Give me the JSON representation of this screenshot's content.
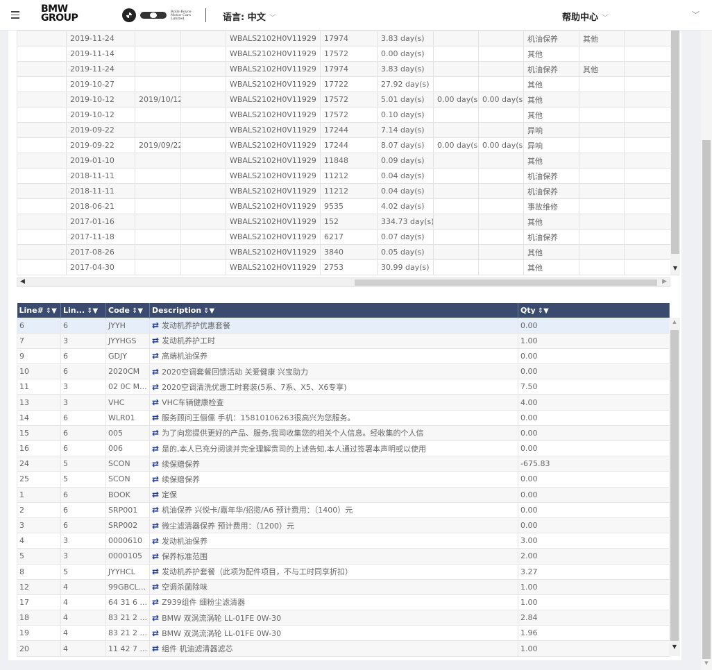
{
  "header": {
    "brand_line1": "BMW",
    "brand_line2": "GROUP",
    "rr_logo_text": "Rolls-Royce Motor Cars Limited",
    "language_label": "语言: 中文",
    "help_label": "帮助中心"
  },
  "repair_orders": {
    "rows": [
      [
        "",
        "2019-11-24",
        "",
        "",
        "WBALS2102H0V11929",
        "17974",
        "3.83 day(s)",
        "",
        "",
        "机油保养",
        "其他",
        ""
      ],
      [
        "",
        "2019-11-14",
        "",
        "",
        "WBALS2102H0V11929",
        "17572",
        "0.00 day(s)",
        "",
        "",
        "其他",
        "",
        ""
      ],
      [
        "",
        "2019-11-24",
        "",
        "",
        "WBALS2102H0V11929",
        "17974",
        "3.83 day(s)",
        "",
        "",
        "机油保养",
        "其他",
        ""
      ],
      [
        "",
        "2019-10-27",
        "",
        "",
        "WBALS2102H0V11929",
        "17722",
        "27.92 day(s)",
        "",
        "",
        "其他",
        "",
        ""
      ],
      [
        "",
        "2019-10-12",
        "2019/10/12",
        "",
        "WBALS2102H0V11929",
        "17572",
        "5.01 day(s)",
        "0.00 day(s)",
        "0.00 day(s)",
        "其他",
        "",
        ""
      ],
      [
        "",
        "2019-10-12",
        "",
        "",
        "WBALS2102H0V11929",
        "17572",
        "0.10 day(s)",
        "",
        "",
        "其他",
        "",
        ""
      ],
      [
        "",
        "2019-09-22",
        "",
        "",
        "WBALS2102H0V11929",
        "17244",
        "7.14 day(s)",
        "",
        "",
        "异响",
        "",
        ""
      ],
      [
        "",
        "2019-09-22",
        "2019/09/22",
        "",
        "WBALS2102H0V11929",
        "17244",
        "8.07 day(s)",
        "0.00 day(s)",
        "0.00 day(s)",
        "异响",
        "",
        ""
      ],
      [
        "",
        "2019-01-10",
        "",
        "",
        "WBALS2102H0V11929",
        "11848",
        "0.09 day(s)",
        "",
        "",
        "其他",
        "",
        ""
      ],
      [
        "",
        "2018-11-11",
        "",
        "",
        "WBALS2102H0V11929",
        "11212",
        "0.04 day(s)",
        "",
        "",
        "机油保养",
        "",
        ""
      ],
      [
        "",
        "2018-11-11",
        "",
        "",
        "WBALS2102H0V11929",
        "11212",
        "0.04 day(s)",
        "",
        "",
        "机油保养",
        "",
        ""
      ],
      [
        "",
        "2018-06-21",
        "",
        "",
        "WBALS2102H0V11929",
        "9535",
        "4.02 day(s)",
        "",
        "",
        "事故维修",
        "",
        ""
      ],
      [
        "",
        "2017-01-16",
        "",
        "",
        "WBALS2102H0V11929",
        "152",
        "334.73 day(s)",
        "",
        "",
        "其他",
        "",
        ""
      ],
      [
        "",
        "2017-11-18",
        "",
        "",
        "WBALS2102H0V11929",
        "6217",
        "0.07 day(s)",
        "",
        "",
        "机油保养",
        "",
        ""
      ],
      [
        "",
        "2017-08-26",
        "",
        "",
        "WBALS2102H0V11929",
        "3840",
        "0.05 day(s)",
        "",
        "",
        "其他",
        "",
        ""
      ],
      [
        "",
        "2017-04-30",
        "",
        "",
        "WBALS2102H0V11929",
        "2753",
        "30.99 day(s)",
        "",
        "",
        "其他",
        "",
        ""
      ]
    ]
  },
  "lines": {
    "headers": [
      "Line#",
      "Lin...",
      "Code",
      "Description",
      "Qty"
    ],
    "rows": [
      [
        "6",
        "6",
        "JYYH",
        "发动机养护优惠套餐",
        "0.00"
      ],
      [
        "7",
        "3",
        "JYYHGS",
        "发动机养护工时",
        "1.00"
      ],
      [
        "9",
        "6",
        "GDJY",
        "高端机油保养",
        "0.00"
      ],
      [
        "10",
        "6",
        "2020CM",
        "2020空调套餐回馈活动 关爱健康 兴宝助力",
        "0.00"
      ],
      [
        "11",
        "3",
        "02 0C M...",
        "2020空调清洗优惠工时套装(5系、7系、X5、X6专享)",
        "7.50"
      ],
      [
        "13",
        "3",
        "VHC",
        "VHC车辆健康检查",
        "4.00"
      ],
      [
        "14",
        "6",
        "WLR01",
        "服务顾问王俪儒 手机：15810106263很高兴为您服务。",
        "0.00"
      ],
      [
        "15",
        "6",
        "005",
        "为了向您提供更好的产品、服务,我司收集您的相关个人信息。经收集的个人信",
        "0.00"
      ],
      [
        "16",
        "6",
        "006",
        "是的,本人已充分阅读并完全理解贵司的上述告知,本人通过签署本声明或以使用",
        "0.00"
      ],
      [
        "24",
        "5",
        "SCON",
        "续保赠保养",
        "-675.83"
      ],
      [
        "25",
        "5",
        "SCON",
        "续保赠保养",
        "0.00"
      ],
      [
        "1",
        "6",
        "BOOK",
        "定保",
        "0.00"
      ],
      [
        "2",
        "6",
        "SRP001",
        "机油保养 兴悦卡/嘉年华/招揽/A6 预计费用：（1400）元",
        "0.00"
      ],
      [
        "3",
        "6",
        "SRP002",
        "微尘滤清器保养 预计费用：（1200）元",
        "0.00"
      ],
      [
        "4",
        "3",
        "0000610",
        "发动机油保养",
        "3.00"
      ],
      [
        "5",
        "3",
        "0000105",
        "保养标准范围",
        "2.00"
      ],
      [
        "8",
        "5",
        "JYYHCL",
        "发动机养护套餐（此项为配件项目，不与工时同享折扣）",
        "3.27"
      ],
      [
        "12",
        "4",
        "99GBCL...",
        "空调杀菌除味",
        "1.00"
      ],
      [
        "17",
        "4",
        "64 31 6 ...",
        "Z939组件 细粉尘滤清器",
        "1.00"
      ],
      [
        "18",
        "4",
        "83 21 2 ...",
        "BMW 双涡流涡轮 LL-01FE 0W-30",
        "2.84"
      ],
      [
        "19",
        "4",
        "83 21 2 ...",
        "BMW 双涡流涡轮 LL-01FE 0W-30",
        "1.96"
      ],
      [
        "20",
        "4",
        "11 42 7 ...",
        "组件 机油滤清器滤芯",
        "1.00"
      ]
    ]
  },
  "icons": {
    "menu": "hamburger-icon",
    "chevron": "chevron-down-icon",
    "line_item": "swap-arrows-icon",
    "sort_filter": "sort-filter-icon"
  },
  "colors": {
    "header_bg": "#3a4b6f",
    "line_icon": "#1f3a93",
    "selected_row": "#e5eef9"
  }
}
